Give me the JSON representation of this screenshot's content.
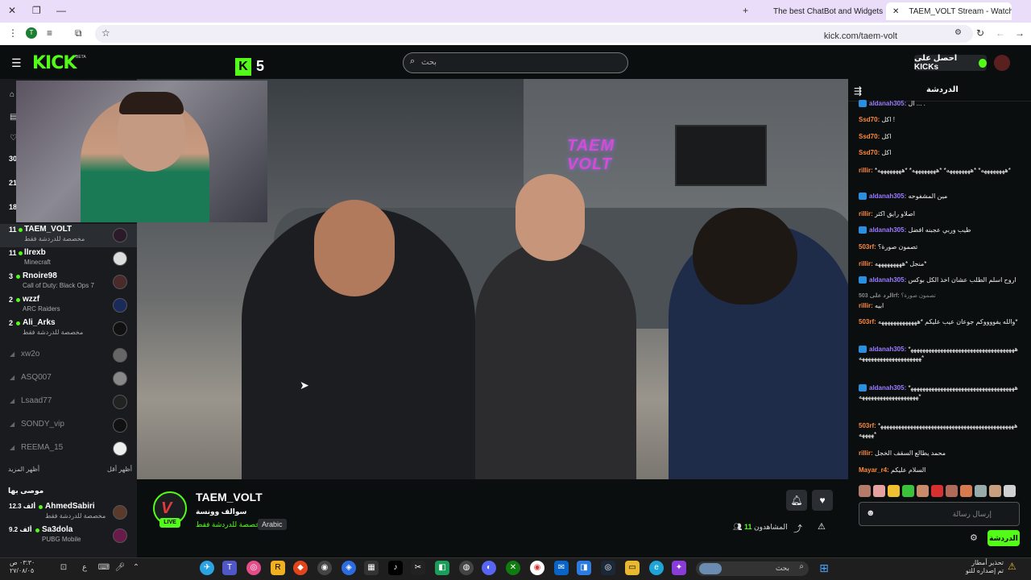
{
  "browser": {
    "tabs": [
      {
        "label": "The best ChatBot and Widgets",
        "fav_color": "#3b82f6"
      },
      {
        "label": "TAEM_VOLT Stream - Watch",
        "fav_color": "#53fc18"
      }
    ],
    "url": "kick.com/taem-volt"
  },
  "header": {
    "logo": "KICK",
    "logo_beta": "BETA",
    "overlay_logo": "5",
    "search_placeholder": "بحث",
    "get_kicks": "احصل على KICKs"
  },
  "sidebar": {
    "channels": [
      {
        "count": "11",
        "name": "TAEM_VOLT",
        "game": "مخصصة للدردشة فقط",
        "selected": true
      },
      {
        "count": "11",
        "name": "llrexb",
        "game": "Minecraft"
      },
      {
        "count": "3",
        "name": "Rnoire98",
        "game": "Call of Duty: Black Ops 7"
      },
      {
        "count": "2",
        "name": "wzzf",
        "game": "ARC Raiders"
      },
      {
        "count": "2",
        "name": "Ali_Arks",
        "game": "مخصصة للدردشة فقط"
      }
    ],
    "offline": [
      "xw2o",
      "ASQ007",
      "Lsaad77",
      "SONDY_vip",
      "REEMA_15"
    ],
    "show_more": "أظهر المزيد",
    "show_less": "أظهر أقل",
    "recommended_title": "موصى بها",
    "recommended": [
      {
        "count": "12.3 ألف",
        "name": "AhmedSabiri",
        "game": "مخصصة للدردشة فقط"
      },
      {
        "count": "9.2 ألف",
        "name": "Sa3dola",
        "game": "PUBG Mobile"
      }
    ],
    "left_counts": [
      "30",
      "21",
      "18"
    ]
  },
  "stream": {
    "channel": "TAEM_VOLT",
    "title": "سوالف وونسة",
    "category": "مخصصة للدردشة فقط",
    "language": "Arabic",
    "live": "LIVE",
    "viewers_label": "المشاهدون",
    "viewers": "11",
    "neon_sign": "TAEM VOLT"
  },
  "chat": {
    "title": "الدردشة",
    "input_placeholder": "إرسال رسالة",
    "send_label": "الدردشة",
    "messages": [
      {
        "user": "aldanah305:",
        "color": "#9b7cff",
        "badge": true,
        "text": "ال ... ."
      },
      {
        "user": "Ssd70:",
        "color": "#ff8a3d",
        "text": "اكل !"
      },
      {
        "user": "Ssd70:",
        "color": "#ff8a3d",
        "text": "اكل"
      },
      {
        "user": "Ssd70:",
        "color": "#ff8a3d",
        "text": "اكل"
      },
      {
        "user": "rillir:",
        "color": "#ff8a3d",
        "text": "*ههههههههه* *ههههههههه* *ههههههههه* *ههههههههه*"
      },
      {
        "user": "aldanah305:",
        "color": "#9b7cff",
        "badge": true,
        "text": "مين المشفوحه"
      },
      {
        "user": "rillir:",
        "color": "#ff8a3d",
        "text": "اصلاو رايق اكثر"
      },
      {
        "user": "aldanah305:",
        "color": "#9b7cff",
        "badge": true,
        "text": "طيب وربي عجبنه افضل"
      },
      {
        "user": "503rf:",
        "color": "#ff8a3d",
        "text": "تصمون صورة؟"
      },
      {
        "user": "rillir:",
        "color": "#ff8a3d",
        "text": "منجل *هههههههههه*"
      },
      {
        "user": "aldanah305:",
        "color": "#9b7cff",
        "badge": true,
        "text": "اروح اسلم الطلب عشان اخذ الكل بوكس"
      },
      {
        "user": "الرد على 503rf:",
        "color": "#888888",
        "text": "تصمون صورة؟"
      },
      {
        "user": "rillir:",
        "color": "#ff8a3d",
        "text": "ابيه"
      },
      {
        "user": "503rf:",
        "color": "#ff8a3d",
        "text": "والله يفووووكم جوعان عيب عليكم *هههههههههههههه*"
      },
      {
        "user": "aldanah305:",
        "color": "#9b7cff",
        "badge": true,
        "text": "*ههههههههههههههههههههههههههههههههههههههههههههههههههههههههه*"
      },
      {
        "user": "aldanah305:",
        "color": "#9b7cff",
        "badge": true,
        "text": "*هههههههههههههههههههههههههههههههههههههههههههههههههههههههه*"
      },
      {
        "user": "503rf:",
        "color": "#ff8a3d",
        "text": "*ههههههههههههههههههههههههههههههههههههههههههههههههههه*"
      },
      {
        "user": "rillir:",
        "color": "#ff8a3d",
        "text": "محمد يطالع السقف الخجل"
      },
      {
        "user": "Mayar_r4:",
        "color": "#ff8a3d",
        "text": "السلام عليكم"
      }
    ]
  },
  "taskbar": {
    "search": "بحث",
    "time": "٠٣:٣٠ ص",
    "date": "٢٧/٠٨/٠٥",
    "notif_title": "تحذير أمطار",
    "notif_sub": "تم إصداره للتو"
  },
  "colors": {
    "accent": "#53fc18",
    "bg": "#0b0e0f",
    "sidebar": "#191b1f"
  }
}
